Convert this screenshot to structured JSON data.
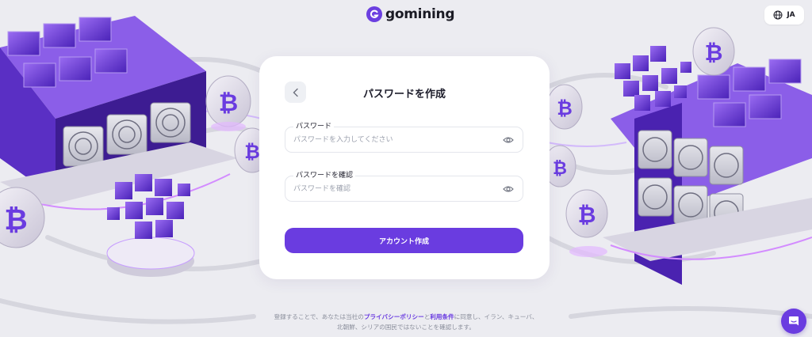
{
  "header": {
    "logo_text": "gomining",
    "language_label": "JA"
  },
  "card": {
    "title": "パスワードを作成",
    "password": {
      "label": "パスワード",
      "placeholder": "パスワードを入力してください",
      "value": ""
    },
    "confirm": {
      "label": "パスワードを確認",
      "placeholder": "パスワードを確認",
      "value": ""
    },
    "submit_label": "アカウント作成"
  },
  "footer": {
    "text_1": "登録することで、あなたは当社の",
    "privacy_link": "プライバシーポリシー",
    "text_2": "と",
    "terms_link": "利用条件",
    "text_3": "に同意し、イラン、キューバ、",
    "text_4": "北朝鮮、シリアの国民ではないことを確認します。"
  },
  "icons": {
    "logo": "gomining-logo-icon",
    "language": "globe-icon",
    "back": "chevron-left-icon",
    "reveal": "eye-icon",
    "chat": "chat-bubble-icon"
  },
  "colors": {
    "accent": "#6a3ce0",
    "background": "#ececf1",
    "card": "#ffffff"
  }
}
